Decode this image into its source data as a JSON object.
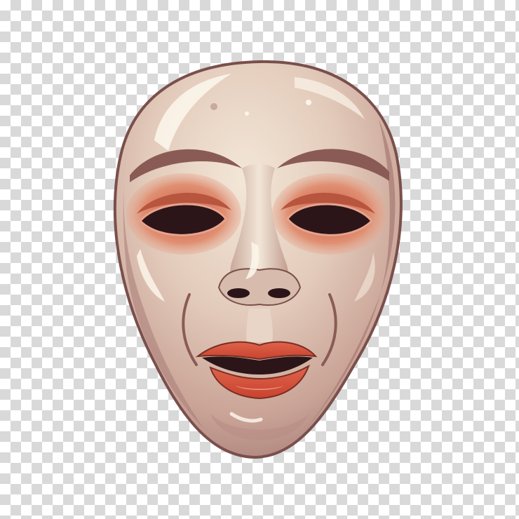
{
  "image": {
    "subject": "mask-illustration",
    "background_pattern": "transparency-checkerboard",
    "colors": {
      "checker_light": "#ffffff",
      "checker_dark": "#d9d9d9",
      "mask_base": "#e6d2c3",
      "mask_shadow": "#b98f86",
      "mask_outline": "#7a4f4c",
      "eye_socket": "#d9785f",
      "eye_hole": "#2b1518",
      "lips": "#d8543f",
      "highlight": "#fbf5ea"
    }
  }
}
